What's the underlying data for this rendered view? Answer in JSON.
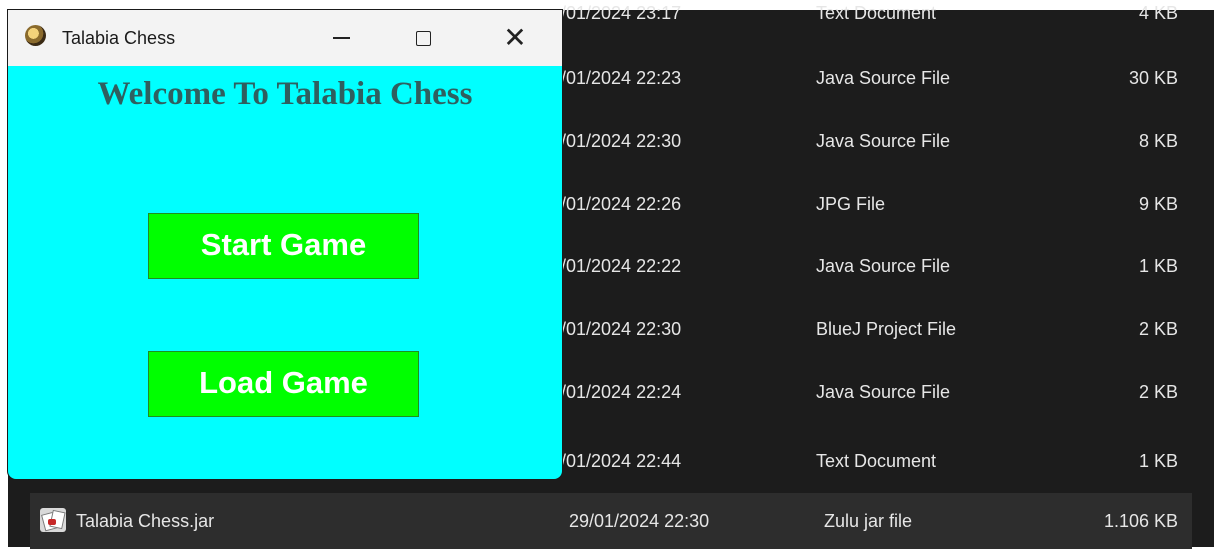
{
  "window": {
    "title": "Talabia Chess",
    "welcome_text": "Welcome To Talabia Chess",
    "start_button_label": "Start Game",
    "load_button_label": "Load Game",
    "minimize_symbol": "—",
    "maximize_symbol": "☐",
    "close_symbol": "✕",
    "icon": "chess-app-icon"
  },
  "colors": {
    "window_background": "#00ffff",
    "button_green": "#00ff00",
    "welcome_text": "#2f5f5f",
    "explorer_background": "#1c1c1c"
  },
  "file_list": {
    "rows": [
      {
        "date": "/01/2024 23:17",
        "type": "Text Document",
        "size": "4 KB"
      },
      {
        "date": "/01/2024 22:23",
        "type": "Java Source File",
        "size": "30 KB"
      },
      {
        "date": "/01/2024 22:30",
        "type": "Java Source File",
        "size": "8 KB"
      },
      {
        "date": "/01/2024 22:26",
        "type": "JPG File",
        "size": "9 KB"
      },
      {
        "date": "/01/2024 22:22",
        "type": "Java Source File",
        "size": "1 KB"
      },
      {
        "date": "/01/2024 22:30",
        "type": "BlueJ Project File",
        "size": "2 KB"
      },
      {
        "date": "/01/2024 22:24",
        "type": "Java Source File",
        "size": "2 KB"
      },
      {
        "date": "/01/2024 22:44",
        "type": "Text Document",
        "size": "1 KB"
      }
    ],
    "selected_row": {
      "name": "Talabia Chess.jar",
      "date": "29/01/2024 22:30",
      "type": "Zulu jar file",
      "size": "1.106 KB",
      "icon": "jar-file-icon"
    }
  }
}
